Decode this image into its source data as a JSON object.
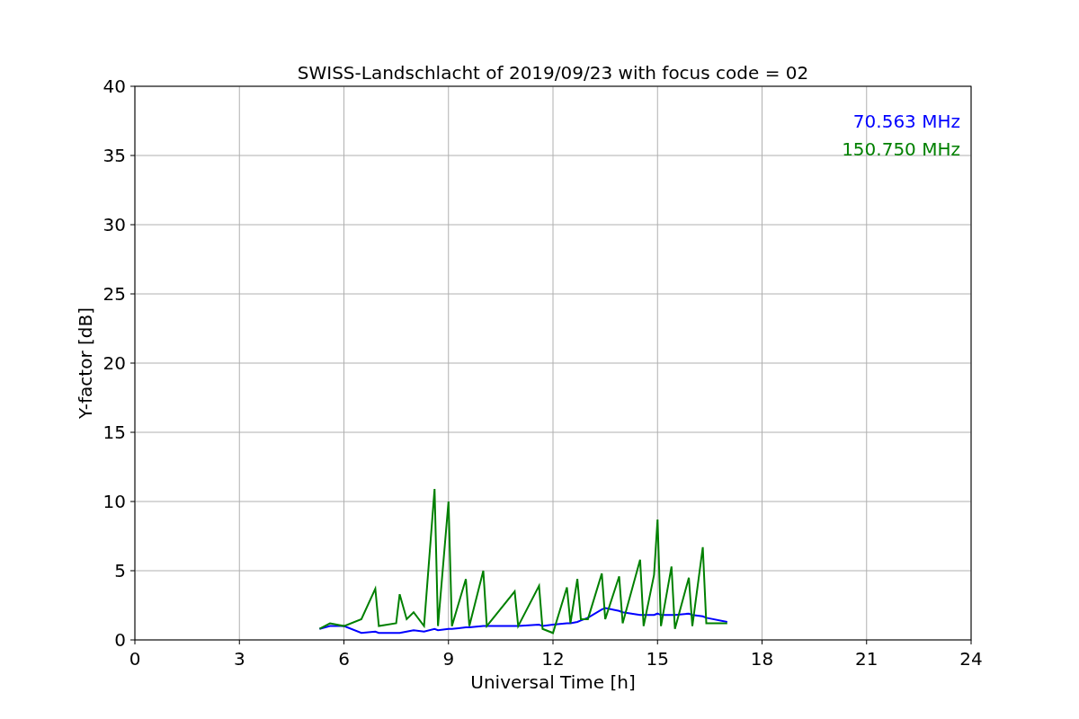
{
  "chart": {
    "chart_data": {
      "type": "line",
      "title": "SWISS-Landschlacht of 2019/09/23 with focus code = 02",
      "xlabel": "Universal Time [h]",
      "ylabel": "Y-factor [dB]",
      "x": [
        5.3,
        5.6,
        6.0,
        6.5,
        6.9,
        7.0,
        7.5,
        7.6,
        7.8,
        8.0,
        8.3,
        8.6,
        8.7,
        9.0,
        9.1,
        9.5,
        9.6,
        10.0,
        10.1,
        10.9,
        11.0,
        11.6,
        11.7,
        12.0,
        12.4,
        12.5,
        12.7,
        12.8,
        13.0,
        13.4,
        13.5,
        13.9,
        14.0,
        14.5,
        14.6,
        14.9,
        15.0,
        15.1,
        15.4,
        15.5,
        15.9,
        16.0,
        16.3,
        16.4,
        17.0
      ],
      "series": [
        {
          "name": "70.563 MHz",
          "color": "#0000ff",
          "values": [
            0.8,
            1.0,
            1.0,
            0.5,
            0.6,
            0.5,
            0.5,
            0.5,
            0.6,
            0.7,
            0.6,
            0.8,
            0.7,
            0.8,
            0.8,
            0.9,
            0.9,
            1.0,
            1.0,
            1.0,
            1.0,
            1.1,
            1.0,
            1.1,
            1.2,
            1.2,
            1.3,
            1.4,
            1.6,
            2.2,
            2.3,
            2.1,
            2.0,
            1.8,
            1.8,
            1.8,
            1.9,
            1.8,
            1.8,
            1.8,
            1.9,
            1.8,
            1.7,
            1.6,
            1.3
          ]
        },
        {
          "name": "150.750 MHz",
          "color": "#008000",
          "values": [
            0.8,
            1.2,
            1.0,
            1.5,
            3.7,
            1.0,
            1.2,
            3.3,
            1.5,
            2.0,
            1.0,
            10.9,
            1.0,
            10.0,
            1.0,
            4.4,
            1.0,
            5.0,
            1.0,
            3.5,
            1.0,
            3.9,
            0.8,
            0.5,
            3.8,
            1.2,
            4.4,
            1.5,
            1.5,
            4.8,
            1.5,
            4.6,
            1.2,
            5.8,
            1.0,
            4.7,
            8.7,
            1.0,
            5.3,
            0.8,
            4.5,
            1.0,
            6.7,
            1.2,
            1.2
          ]
        }
      ],
      "xlim": [
        0,
        24
      ],
      "ylim": [
        0,
        40
      ],
      "xticks": [
        0,
        3,
        6,
        9,
        12,
        15,
        18,
        21,
        24
      ],
      "yticks": [
        0,
        5,
        10,
        15,
        20,
        25,
        30,
        35,
        40
      ],
      "grid": true
    }
  }
}
